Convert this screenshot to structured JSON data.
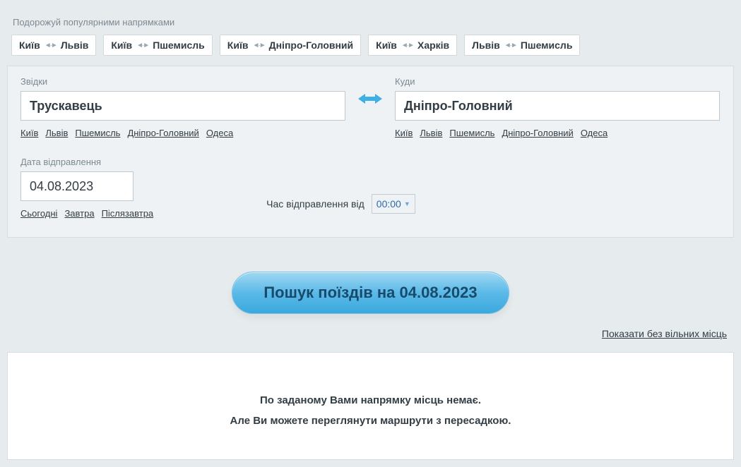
{
  "popular": {
    "heading": "Подорожуй популярними напрямками",
    "routes": [
      {
        "from": "Київ",
        "to": "Львів"
      },
      {
        "from": "Київ",
        "to": "Пшемисль"
      },
      {
        "from": "Київ",
        "to": "Дніпро-Головний"
      },
      {
        "from": "Київ",
        "to": "Харків"
      },
      {
        "from": "Львів",
        "to": "Пшемисль"
      }
    ]
  },
  "form": {
    "from_label": "Звідки",
    "to_label": "Куди",
    "from_value": "Трускавець",
    "to_value": "Дніпро-Головний",
    "quick_from": [
      "Київ",
      "Львів",
      "Пшемисль",
      "Дніпро-Головний",
      "Одеса"
    ],
    "quick_to": [
      "Київ",
      "Львів",
      "Пшемисль",
      "Дніпро-Головний",
      "Одеса"
    ],
    "date_label": "Дата відправлення",
    "date_value": "04.08.2023",
    "date_links": [
      "Сьогодні",
      "Завтра",
      "Післязавтра"
    ],
    "time_label": "Час відправлення від",
    "time_value": "00:00"
  },
  "search_button": "Пошук поїздів на 04.08.2023",
  "show_no_free": "Показати без вільних місць",
  "result": {
    "line1": "По заданому Вами напрямку місць немає.",
    "line2": "Але Ви можете переглянути маршрути з пересадкою."
  }
}
